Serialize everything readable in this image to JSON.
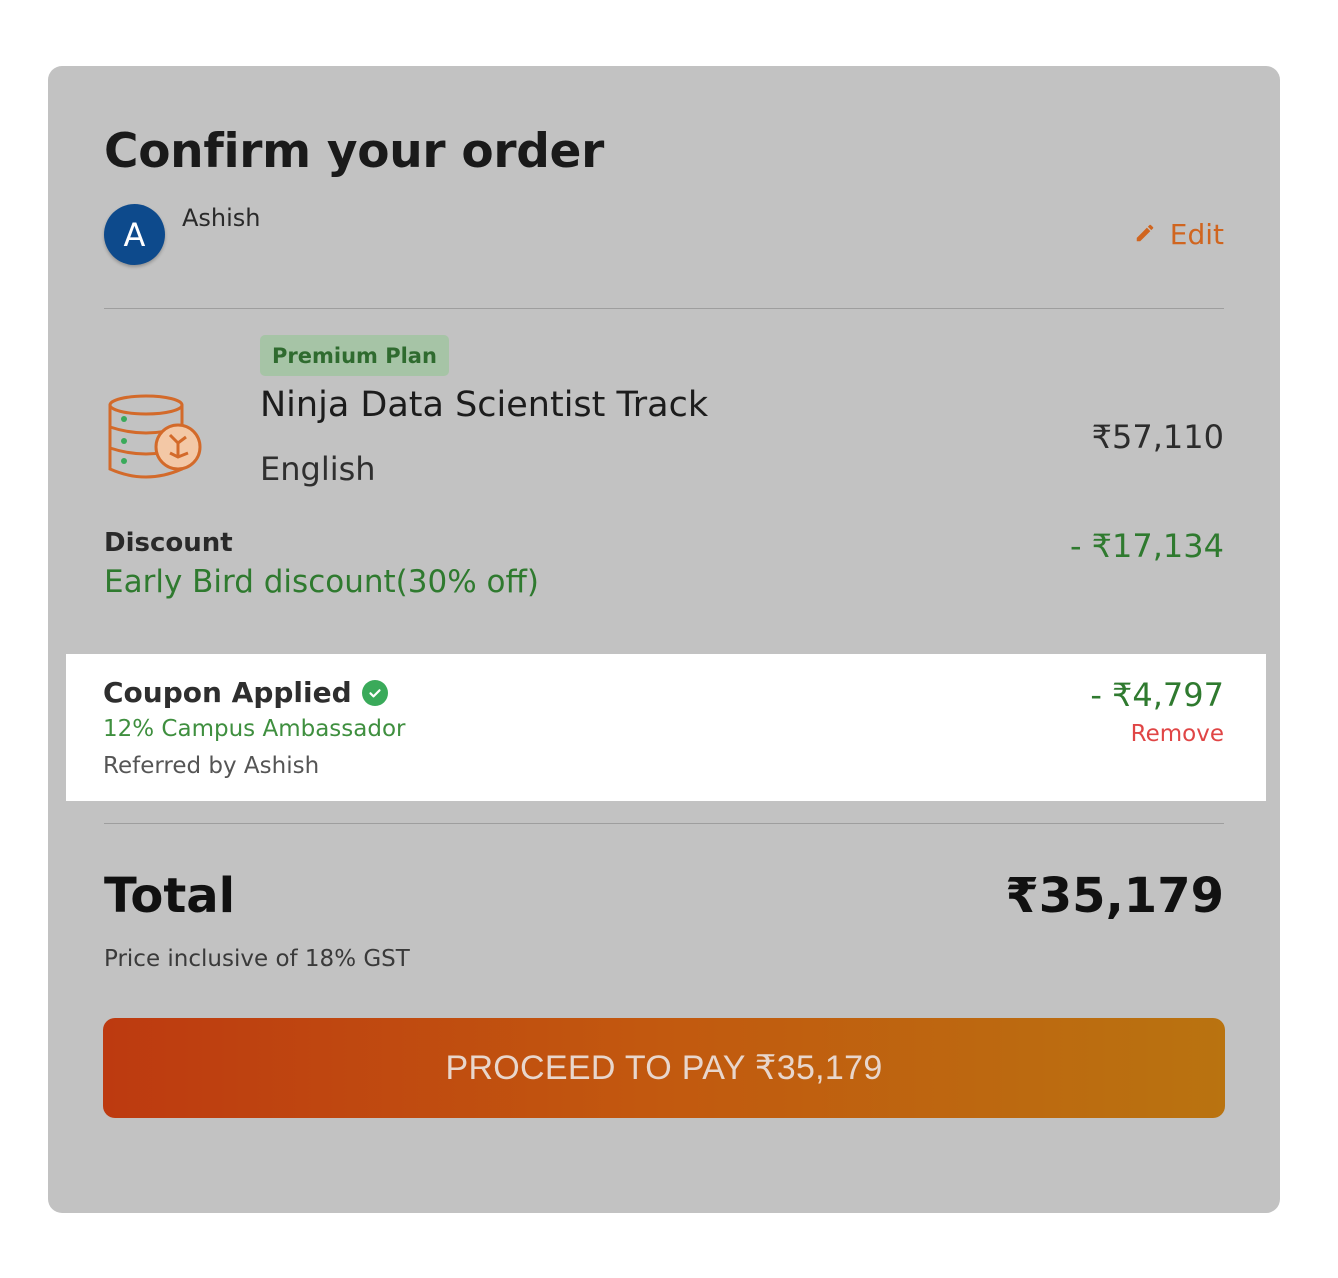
{
  "page": {
    "title": "Confirm your order"
  },
  "user": {
    "avatar_initial": "A",
    "name": "Ashish",
    "edit_label": "Edit"
  },
  "product": {
    "badge": "Premium Plan",
    "name": "Ninja Data Scientist Track",
    "language": "English",
    "price": "₹57,110",
    "icon": "database-brain-icon"
  },
  "discount": {
    "label": "Discount",
    "description": "Early Bird discount(30% off)",
    "amount": "- ₹17,134"
  },
  "coupon": {
    "title": "Coupon Applied",
    "code": "12% Campus Ambassador",
    "referred_by": "Referred by Ashish",
    "amount": "- ₹4,797",
    "remove_label": "Remove"
  },
  "total": {
    "label": "Total",
    "amount": "₹35,179",
    "note": "Price inclusive of 18% GST"
  },
  "pay_button": {
    "label": "PROCEED TO PAY ₹35,179"
  },
  "colors": {
    "overlay": "#c2c2c2",
    "accent_green": "#2f7a2f",
    "accent_orange": "#d0651f",
    "remove_red": "#e04545",
    "avatar_blue": "#0d4a8c"
  }
}
